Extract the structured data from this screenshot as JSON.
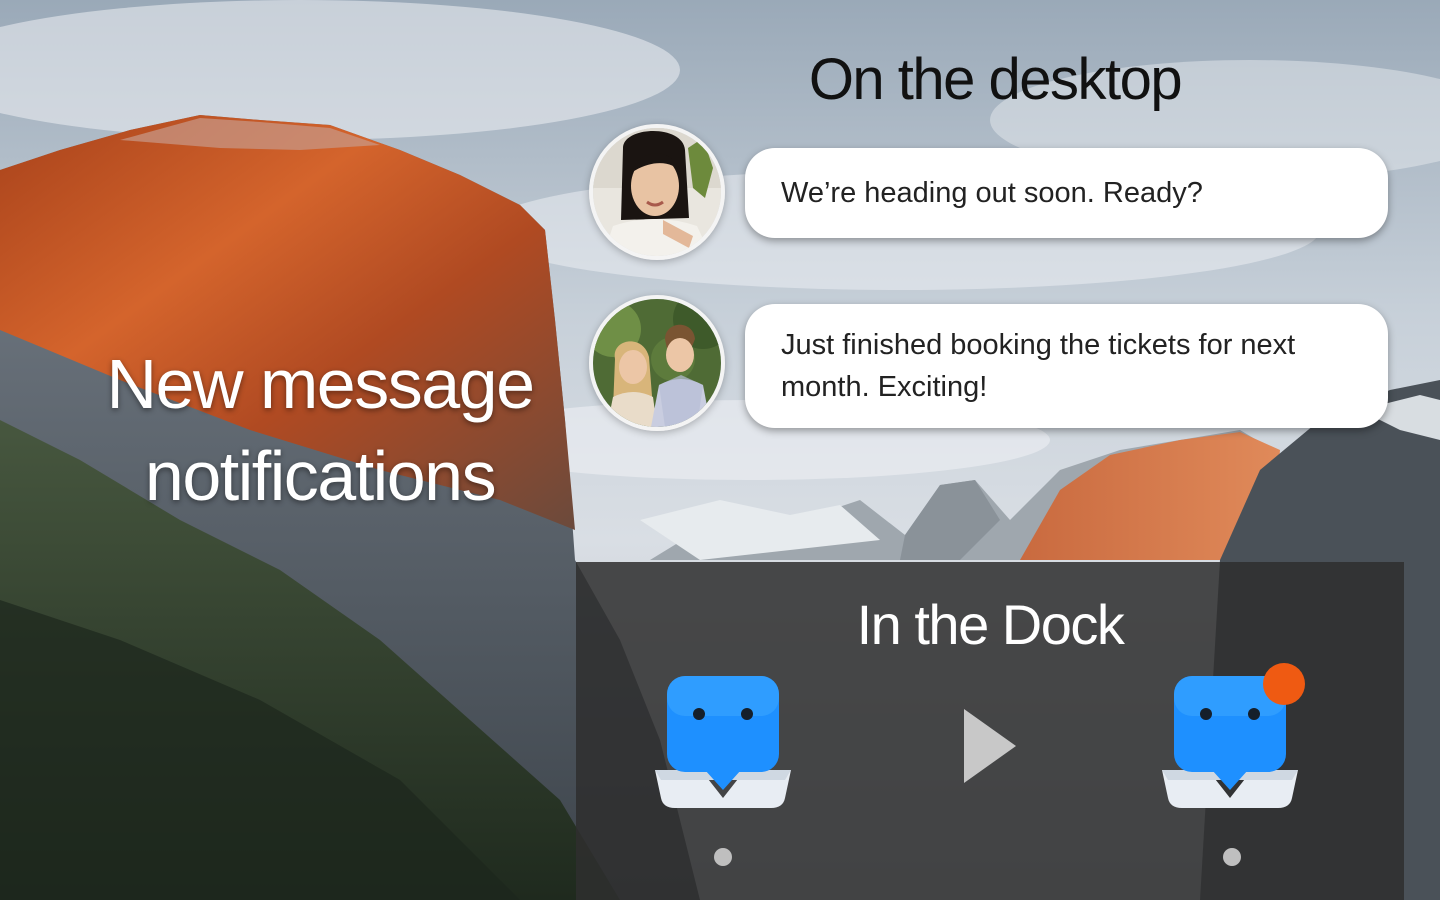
{
  "headline": {
    "line1": "New message",
    "line2": "notifications"
  },
  "desktop": {
    "title": "On the desktop",
    "notifications": [
      {
        "avatar": "avatar-woman-photo",
        "message": "We’re heading out soon. Ready?"
      },
      {
        "avatar": "avatar-couple-photo",
        "message": "Just finished booking the tickets for next month. Exciting!"
      }
    ]
  },
  "dock": {
    "title": "In the Dock",
    "before_icon": "messenger-app-icon",
    "after_icon": "messenger-app-icon-with-badge",
    "arrow_icon": "play-arrow-icon",
    "badge_color": "#ef5a12",
    "app_color": "#1e90ff"
  }
}
